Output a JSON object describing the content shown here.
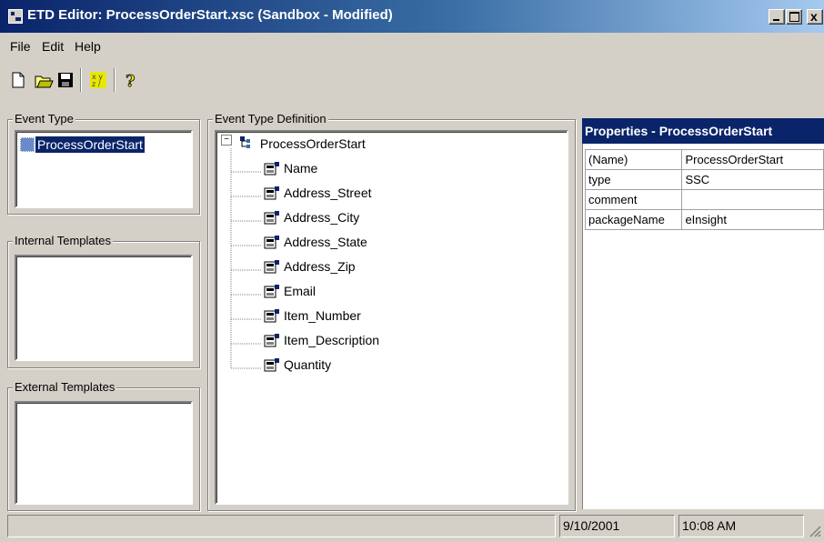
{
  "window": {
    "title": "ETD Editor: ProcessOrderStart.xsc (Sandbox - Modified)",
    "minimize_glyph": "_",
    "close_glyph": "x"
  },
  "menu": [
    "File",
    "Edit",
    "Help"
  ],
  "toolbar": [
    "new-icon",
    "open-icon",
    "save-icon",
    "grid-icon",
    "help-icon"
  ],
  "event_type": {
    "label": "Event Type",
    "items": [
      "ProcessOrderStart"
    ]
  },
  "internal_templates": {
    "label": "Internal Templates"
  },
  "external_templates": {
    "label": "External Templates"
  },
  "definition": {
    "label": "Event Type Definition",
    "root": "ProcessOrderStart",
    "expander": "⊟",
    "fields": [
      "Name",
      "Address_Street",
      "Address_City",
      "Address_State",
      "Address_Zip",
      "Email",
      "Item_Number",
      "Item_Description",
      "Quantity"
    ]
  },
  "properties": {
    "title": "Properties - ProcessOrderStart",
    "rows": [
      [
        "(Name)",
        "ProcessOrderStart"
      ],
      [
        "type",
        "SSC"
      ],
      [
        "comment",
        ""
      ],
      [
        "packageName",
        "eInsight"
      ]
    ]
  },
  "status": {
    "message": "",
    "date": "9/10/2001",
    "time": "10:08 AM"
  },
  "colors": {
    "titlebar": "#0a246a",
    "selection": "#0a246a",
    "face": "#d4d0c8"
  }
}
